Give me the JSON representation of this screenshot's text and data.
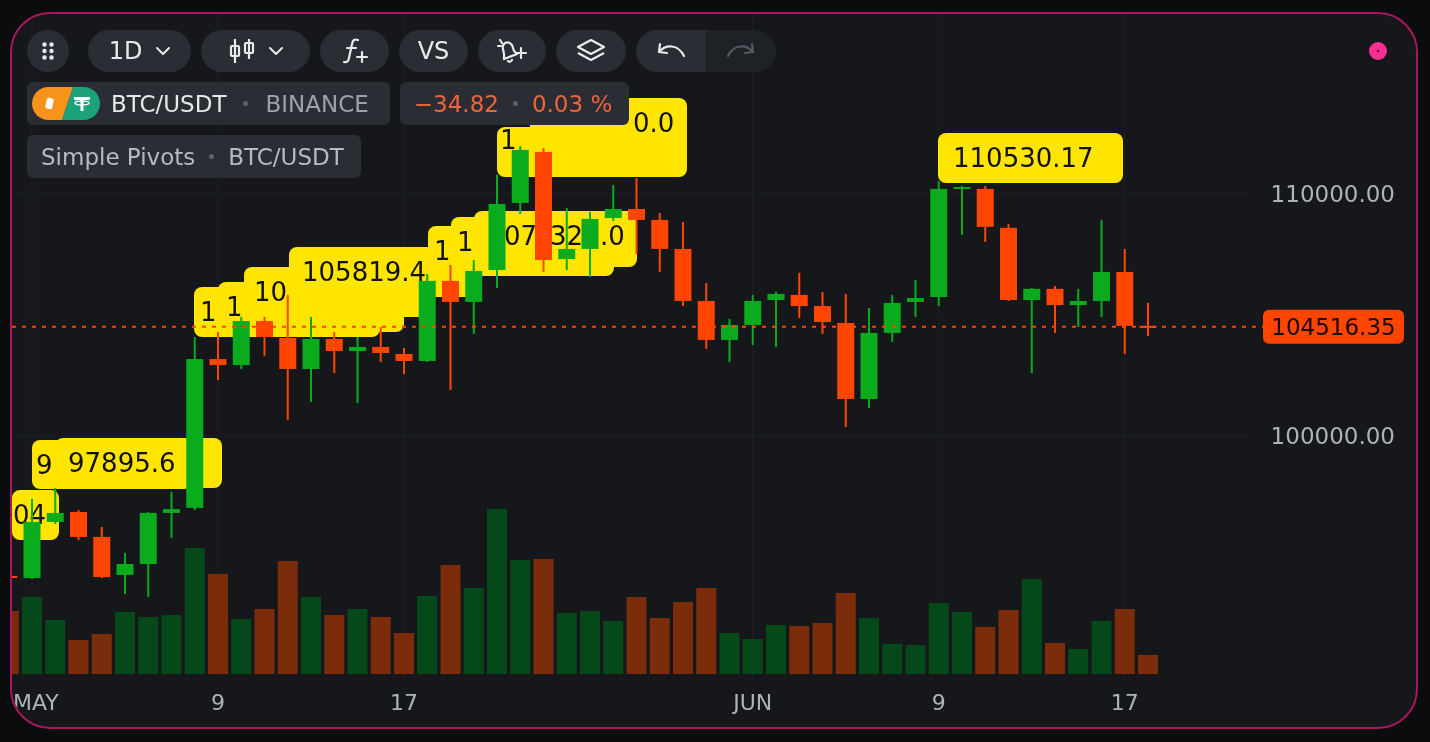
{
  "toolbar": {
    "buttons": [
      {
        "kind": "grip",
        "disabled": false
      },
      {
        "kind": "interval",
        "label": "1D",
        "disabled": false
      },
      {
        "kind": "chart-type",
        "disabled": false
      },
      {
        "kind": "indicators",
        "disabled": false
      },
      {
        "kind": "compare",
        "label": "VS",
        "disabled": false
      },
      {
        "kind": "alert",
        "disabled": false
      },
      {
        "kind": "layers",
        "disabled": false
      },
      {
        "kind": "undo",
        "disabled": false
      },
      {
        "kind": "redo",
        "disabled": true
      }
    ]
  },
  "legend": {
    "symbol": {
      "name": "BTC/USDT",
      "exchange": "BINANCE"
    },
    "change": {
      "value": "−34.82",
      "percent": "0.03 %"
    },
    "indicator": {
      "name": "Simple Pivots",
      "source": "BTC/USDT"
    }
  },
  "chart": {
    "pivot_labels": [
      {
        "texts": [
          "0.0"
        ]
      },
      {
        "texts": [
          "110530.17"
        ]
      },
      {
        "texts": [
          "1"
        ]
      },
      {
        "texts": [
          "07",
          "32",
          ".0"
        ]
      },
      {
        "texts": [
          "1"
        ]
      },
      {
        "texts": [
          "1"
        ]
      },
      {
        "texts": [
          "105819.4"
        ]
      },
      {
        "texts": [
          "10"
        ]
      },
      {
        "texts": [
          "1"
        ]
      },
      {
        "texts": [
          "1"
        ]
      },
      {
        "texts": [
          "97895.6"
        ]
      },
      {
        "texts": [
          "9"
        ]
      },
      {
        "texts": [
          "04"
        ]
      }
    ],
    "price_axis": [
      "110000.00",
      "100000.00"
    ],
    "last_price": "104516.35",
    "time_axis": [
      "MAY",
      "9",
      "17",
      "JUN",
      "9",
      "17"
    ]
  }
}
